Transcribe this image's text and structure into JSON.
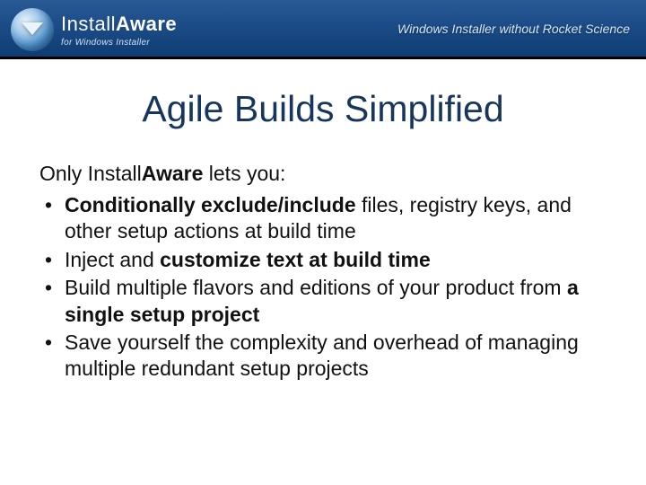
{
  "header": {
    "brand_prefix": "Install",
    "brand_bold": "Aware",
    "brand_sub": "for Windows Installer",
    "tagline": "Windows Installer without Rocket Science"
  },
  "slide": {
    "title": "Agile Builds Simplified",
    "intro_pre": "Only Install",
    "intro_bold": "Aware",
    "intro_post": " lets you:",
    "bullets": [
      {
        "bold1": "Conditionally exclude/include",
        "rest1": " files, registry keys, and other setup actions at build time"
      },
      {
        "pre": "Inject and ",
        "bold1": "customize text at build time",
        "rest1": ""
      },
      {
        "pre": "Build multiple flavors and editions of your product from ",
        "bold1": "a single setup project",
        "rest1": ""
      },
      {
        "pre": "Save yourself the complexity and overhead of managing multiple redundant setup projects",
        "bold1": "",
        "rest1": ""
      }
    ]
  }
}
